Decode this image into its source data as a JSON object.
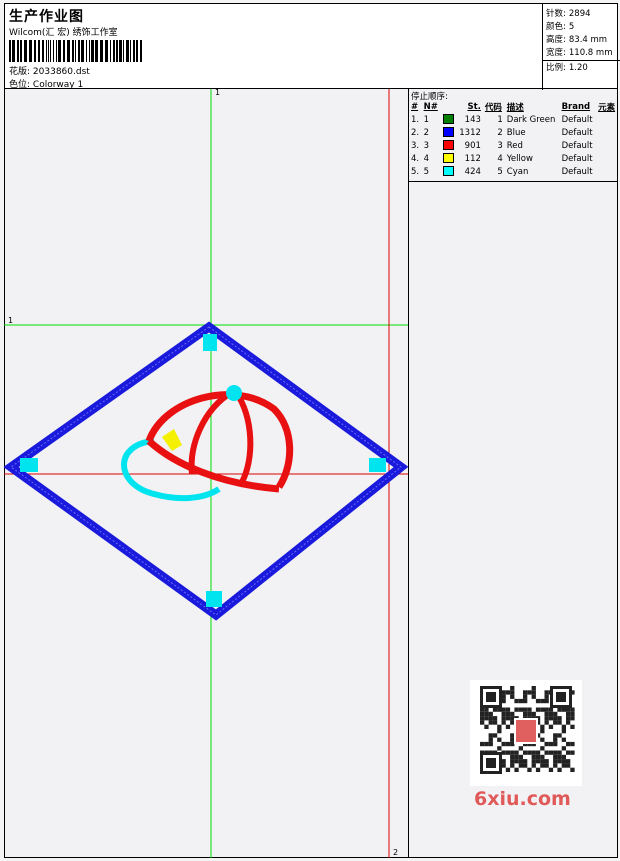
{
  "header": {
    "title": "生产作业图",
    "subtitle": "Wilcom(汇 宏) 绣饰工作室",
    "file_label": "花版:",
    "file_name": "2033860.dst",
    "colorway_label": "色位:",
    "colorway": "Colorway 1"
  },
  "stats": {
    "stitches_label": "针数:",
    "stitches": "2894",
    "colors_label": "颜色:",
    "colors": "5",
    "height_label": "高度:",
    "height": "83.4 mm",
    "width_label": "宽度:",
    "width": "110.8 mm",
    "scale_label": "比例:",
    "scale": "1.20"
  },
  "stop_sequence": {
    "title": "停止顺序:",
    "columns": [
      "#",
      "N#",
      "St.",
      "代码",
      "描述",
      "Brand",
      "元素"
    ],
    "rows": [
      {
        "idx": "1.",
        "n": "1",
        "st": "143",
        "code": "1",
        "desc": "Dark Green",
        "brand": "Default",
        "color": "#008000"
      },
      {
        "idx": "2.",
        "n": "2",
        "st": "1312",
        "code": "2",
        "desc": "Blue",
        "brand": "Default",
        "color": "#0000ff"
      },
      {
        "idx": "3.",
        "n": "3",
        "st": "901",
        "code": "3",
        "desc": "Red",
        "brand": "Default",
        "color": "#ff0000"
      },
      {
        "idx": "4.",
        "n": "4",
        "st": "112",
        "code": "4",
        "desc": "Yellow",
        "brand": "Default",
        "color": "#ffff00"
      },
      {
        "idx": "5.",
        "n": "5",
        "st": "424",
        "code": "5",
        "desc": "Cyan",
        "brand": "Default",
        "color": "#00ffff"
      }
    ]
  },
  "guides": {
    "marker_1": "1",
    "marker_2": "2"
  },
  "watermark": {
    "brand": "6xiu.com"
  },
  "colors": {
    "green_guide": "#00dd00",
    "red_guide": "#dd0000",
    "blue": "#1a1adc",
    "red": "#e81010",
    "cyan": "#00e4f0",
    "yellow": "#f4f000"
  }
}
